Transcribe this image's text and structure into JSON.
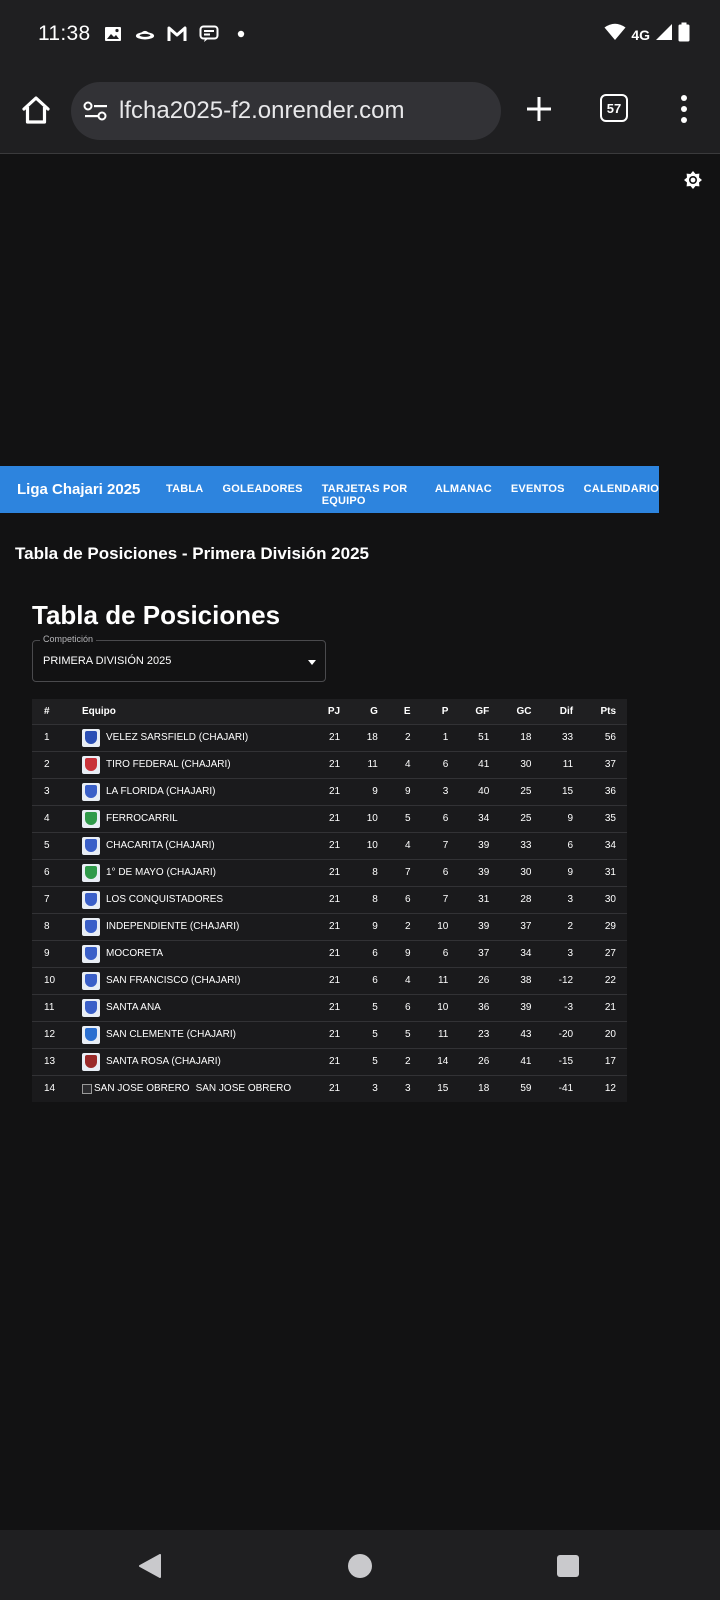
{
  "status_bar": {
    "time": "11:38",
    "notification_icons": [
      "gallery-icon",
      "ufo-icon",
      "gmail-icon",
      "message-icon",
      "dot-icon"
    ],
    "network": "4G"
  },
  "browser": {
    "url": "lfcha2025-f2.onrender.com",
    "tab_count": "57"
  },
  "site": {
    "brand": "Liga Chajari 2025",
    "nav": [
      "TABLA",
      "GOLEADORES",
      "TARJETAS POR EQUIPO",
      "ALMANAC",
      "EVENTOS",
      "CALENDARIO"
    ],
    "nav_color": "#2d84de"
  },
  "page": {
    "heading": "Tabla de Posiciones - Primera División 2025",
    "card_title": "Tabla de Posiciones",
    "competition_label": "Competición",
    "competition_value": "PRIMERA DIVISIÓN 2025"
  },
  "table": {
    "headers": [
      "#",
      "Equipo",
      "PJ",
      "G",
      "E",
      "P",
      "GF",
      "GC",
      "Dif",
      "Pts"
    ],
    "rows": [
      {
        "pos": "1",
        "team": "VELEZ SARSFIELD (CHAJARI)",
        "pj": "21",
        "g": "18",
        "e": "2",
        "p": "1",
        "gf": "51",
        "gc": "18",
        "dif": "33",
        "pts": "56",
        "crest": "#2b4fb5"
      },
      {
        "pos": "2",
        "team": "TIRO FEDERAL (CHAJARI)",
        "pj": "21",
        "g": "11",
        "e": "4",
        "p": "6",
        "gf": "41",
        "gc": "30",
        "dif": "11",
        "pts": "37",
        "crest": "#c8323a"
      },
      {
        "pos": "3",
        "team": "LA FLORIDA (CHAJARI)",
        "pj": "21",
        "g": "9",
        "e": "9",
        "p": "3",
        "gf": "40",
        "gc": "25",
        "dif": "15",
        "pts": "36",
        "crest": "#3a5fc8"
      },
      {
        "pos": "4",
        "team": "FERROCARRIL",
        "pj": "21",
        "g": "10",
        "e": "5",
        "p": "6",
        "gf": "34",
        "gc": "25",
        "dif": "9",
        "pts": "35",
        "crest": "#2f9a4a"
      },
      {
        "pos": "5",
        "team": "CHACARITA (CHAJARI)",
        "pj": "21",
        "g": "10",
        "e": "4",
        "p": "7",
        "gf": "39",
        "gc": "33",
        "dif": "6",
        "pts": "34",
        "crest": "#3a5fc8"
      },
      {
        "pos": "6",
        "team": "1° DE MAYO (CHAJARI)",
        "pj": "21",
        "g": "8",
        "e": "7",
        "p": "6",
        "gf": "39",
        "gc": "30",
        "dif": "9",
        "pts": "31",
        "crest": "#2f9a4a"
      },
      {
        "pos": "7",
        "team": "LOS CONQUISTADORES",
        "pj": "21",
        "g": "8",
        "e": "6",
        "p": "7",
        "gf": "31",
        "gc": "28",
        "dif": "3",
        "pts": "30",
        "crest": "#3a5fc8"
      },
      {
        "pos": "8",
        "team": "INDEPENDIENTE (CHAJARI)",
        "pj": "21",
        "g": "9",
        "e": "2",
        "p": "10",
        "gf": "39",
        "gc": "37",
        "dif": "2",
        "pts": "29",
        "crest": "#3a5fc8"
      },
      {
        "pos": "9",
        "team": "MOCORETA",
        "pj": "21",
        "g": "6",
        "e": "9",
        "p": "6",
        "gf": "37",
        "gc": "34",
        "dif": "3",
        "pts": "27",
        "crest": "#3a5fc8"
      },
      {
        "pos": "10",
        "team": "SAN FRANCISCO (CHAJARI)",
        "pj": "21",
        "g": "6",
        "e": "4",
        "p": "11",
        "gf": "26",
        "gc": "38",
        "dif": "-12",
        "pts": "22",
        "crest": "#3a5fc8"
      },
      {
        "pos": "11",
        "team": "SANTA ANA",
        "pj": "21",
        "g": "5",
        "e": "6",
        "p": "10",
        "gf": "36",
        "gc": "39",
        "dif": "-3",
        "pts": "21",
        "crest": "#3a5fc8"
      },
      {
        "pos": "12",
        "team": "SAN CLEMENTE (CHAJARI)",
        "pj": "21",
        "g": "5",
        "e": "5",
        "p": "11",
        "gf": "23",
        "gc": "43",
        "dif": "-20",
        "pts": "20",
        "crest": "#2b6fd0"
      },
      {
        "pos": "13",
        "team": "SANTA ROSA (CHAJARI)",
        "pj": "21",
        "g": "5",
        "e": "2",
        "p": "14",
        "gf": "26",
        "gc": "41",
        "dif": "-15",
        "pts": "17",
        "crest": "#9a2a2a"
      },
      {
        "pos": "14",
        "team": "SAN JOSE OBRERO",
        "crest_alt": "SAN JOSE OBRERO",
        "broken_crest": true,
        "pj": "21",
        "g": "3",
        "e": "3",
        "p": "15",
        "gf": "18",
        "gc": "59",
        "dif": "-41",
        "pts": "12"
      }
    ]
  }
}
